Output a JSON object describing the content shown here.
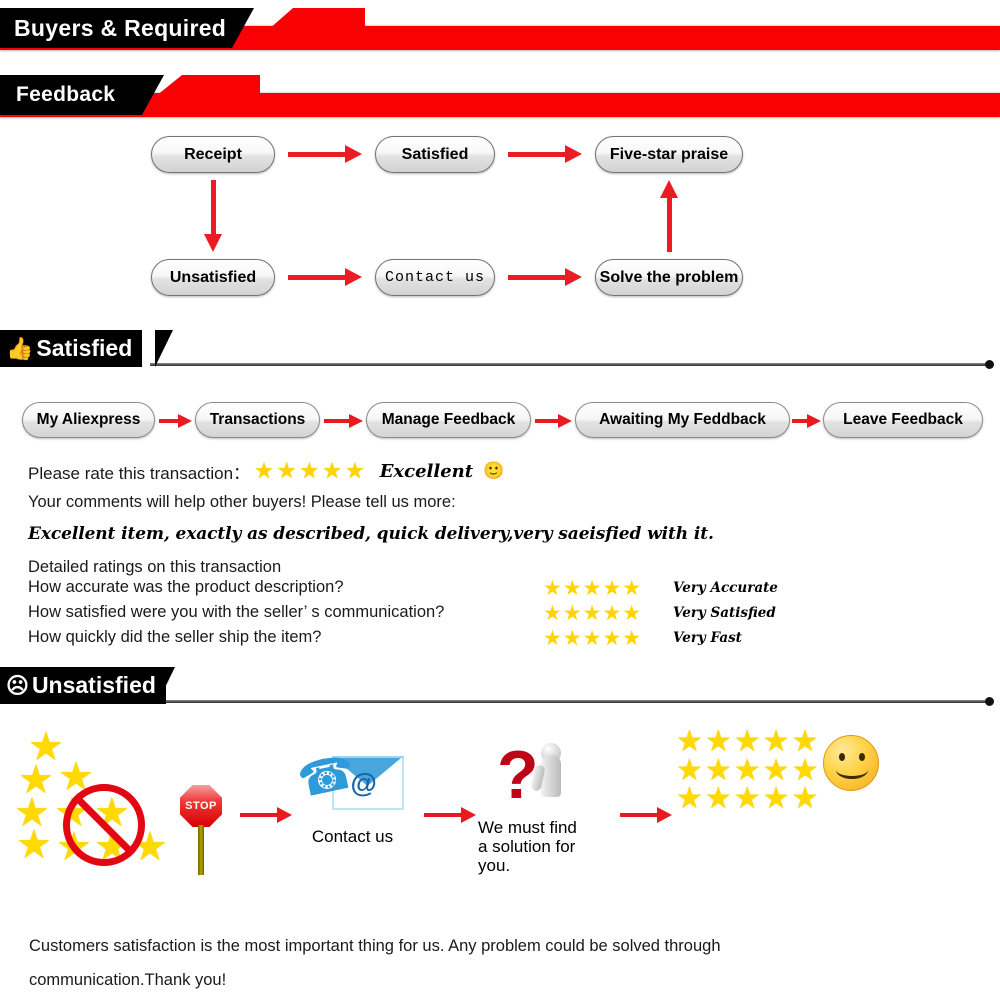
{
  "banners": [
    {
      "label": "Buyers & Required"
    },
    {
      "label": "Feedback"
    }
  ],
  "flowchart": {
    "nodes": {
      "receipt": "Receipt",
      "satisfied": "Satisfied",
      "five_star": "Five-star praise",
      "unsatisfied": "Unsatisfied",
      "contact_us": "Contact us",
      "solve": "Solve the problem"
    }
  },
  "satisfied_section": {
    "badge_label": "Satisfied",
    "badge_icon": "thumbs-up-icon",
    "breadcrumb": [
      "My Aliexpress",
      "Transactions",
      "Manage Feedback",
      "Awaiting My Feddback",
      "Leave Feedback"
    ],
    "rate_prompt": "Please rate this transaction：",
    "rate_stars": "★★★★★",
    "rate_word": "Excellent",
    "rate_smiley": "☺",
    "comments_prompt": "Your comments will help other buyers! Please tell us more:",
    "comment_text": "Excellent item, exactly as described, quick delivery,very saeisfied with it.",
    "detail_heading": "Detailed ratings on this transaction",
    "detail_rows": [
      {
        "question": "How accurate was the product description?",
        "stars": "★★★★★",
        "value": "Very Accurate"
      },
      {
        "question": "How satisfied were you with the seller’ s communication?",
        "stars": "★★★★★",
        "value": "Very Satisfied"
      },
      {
        "question": "How quickly did the seller ship the item?",
        "stars": "★★★★★",
        "value": "Very Fast"
      }
    ]
  },
  "unsatisfied_section": {
    "badge_label": "Unsatisfied",
    "badge_icon": "frowning-face-icon",
    "stop_label": "STOP",
    "contact_caption": "Contact us",
    "solution_caption": "We must find\na solution for\nyou.",
    "good_rating_rows": [
      "★★★★★",
      "★★★★★",
      "★★★★★"
    ]
  },
  "footer": {
    "line1": "Customers satisfaction is the most important thing for us. Any problem could be solved through",
    "line2": "communication.Thank you!"
  },
  "colors": {
    "red": "#f90004",
    "arrow_red": "#e8191f",
    "star_yellow": "#ffd900",
    "black": "#000000"
  }
}
